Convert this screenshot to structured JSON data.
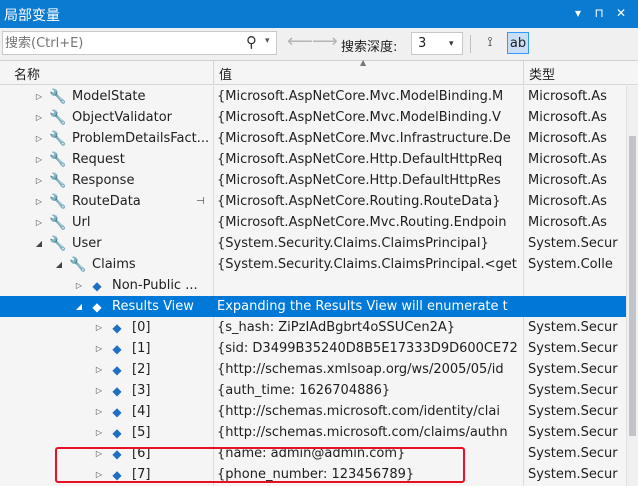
{
  "window": {
    "title": "局部变量",
    "dropdown_glyph": "▾",
    "pin_glyph": "⊓",
    "close_glyph": "✕"
  },
  "toolbar": {
    "search_placeholder": "搜索(Ctrl+E)",
    "search_icon": "⚲",
    "search_dropdown_glyph": "▾",
    "back_glyph": "⟵",
    "forward_glyph": "⟶",
    "depth_label": "搜索深度:",
    "depth_value": "3",
    "depth_dropdown_glyph": "▾",
    "pin_column_glyph": "⟟",
    "view_glyph": "ab"
  },
  "columns": {
    "name": "名称",
    "value": "值",
    "type": "类型"
  },
  "rows": [
    {
      "name": "ModelState",
      "value": "{Microsoft.AspNetCore.Mvc.ModelBinding.M",
      "type": "Microsoft.As",
      "indent": 0,
      "expander": "▷",
      "icon": "wrench-icon",
      "selected": false,
      "pin": false
    },
    {
      "name": "ObjectValidator",
      "value": "{Microsoft.AspNetCore.Mvc.ModelBinding.V",
      "type": "Microsoft.As",
      "indent": 0,
      "expander": "▷",
      "icon": "wrench-icon",
      "selected": false,
      "pin": false
    },
    {
      "name": "ProblemDetailsFact...",
      "value": "{Microsoft.AspNetCore.Mvc.Infrastructure.De",
      "type": "Microsoft.As",
      "indent": 0,
      "expander": "▷",
      "icon": "wrench-icon",
      "selected": false,
      "pin": false
    },
    {
      "name": "Request",
      "value": "{Microsoft.AspNetCore.Http.DefaultHttpReq",
      "type": "Microsoft.As",
      "indent": 0,
      "expander": "▷",
      "icon": "wrench-icon",
      "selected": false,
      "pin": false
    },
    {
      "name": "Response",
      "value": "{Microsoft.AspNetCore.Http.DefaultHttpRes",
      "type": "Microsoft.As",
      "indent": 0,
      "expander": "▷",
      "icon": "wrench-icon",
      "selected": false,
      "pin": false
    },
    {
      "name": "RouteData",
      "value": "{Microsoft.AspNetCore.Routing.RouteData}",
      "type": "Microsoft.As",
      "indent": 0,
      "expander": "▷",
      "icon": "wrench-icon",
      "selected": false,
      "pin": true
    },
    {
      "name": "Url",
      "value": "{Microsoft.AspNetCore.Mvc.Routing.Endpoin",
      "type": "Microsoft.As",
      "indent": 0,
      "expander": "▷",
      "icon": "wrench-icon",
      "selected": false,
      "pin": false
    },
    {
      "name": "User",
      "value": "{System.Security.Claims.ClaimsPrincipal}",
      "type": "System.Secur",
      "indent": 0,
      "expander": "◢",
      "icon": "wrench-icon",
      "selected": false,
      "pin": false
    },
    {
      "name": "Claims",
      "value": "{System.Security.Claims.ClaimsPrincipal.<get",
      "type": "System.Colle",
      "indent": 1,
      "expander": "◢",
      "icon": "wrench-icon",
      "selected": false,
      "pin": false
    },
    {
      "name": "Non-Public ...",
      "value": "",
      "type": "",
      "indent": 2,
      "expander": "▷",
      "icon": "cube-icon",
      "selected": false,
      "pin": false
    },
    {
      "name": "Results View",
      "value": "Expanding the Results View will enumerate t",
      "type": "",
      "indent": 2,
      "expander": "◢",
      "icon": "cube-icon",
      "selected": true,
      "pin": false
    },
    {
      "name": "[0]",
      "value": "{s_hash: ZiPzIAdBgbrt4oSSUCen2A}",
      "type": "System.Secur",
      "indent": 3,
      "expander": "▷",
      "icon": "cube-icon",
      "selected": false,
      "pin": false
    },
    {
      "name": "[1]",
      "value": "{sid: D3499B35240D8B5E17333D9D600CE72",
      "type": "System.Secur",
      "indent": 3,
      "expander": "▷",
      "icon": "cube-icon",
      "selected": false,
      "pin": false
    },
    {
      "name": "[2]",
      "value": "{http://schemas.xmlsoap.org/ws/2005/05/id",
      "type": "System.Secur",
      "indent": 3,
      "expander": "▷",
      "icon": "cube-icon",
      "selected": false,
      "pin": false
    },
    {
      "name": "[3]",
      "value": "{auth_time: 1626704886}",
      "type": "System.Secur",
      "indent": 3,
      "expander": "▷",
      "icon": "cube-icon",
      "selected": false,
      "pin": false
    },
    {
      "name": "[4]",
      "value": "{http://schemas.microsoft.com/identity/clai",
      "type": "System.Secur",
      "indent": 3,
      "expander": "▷",
      "icon": "cube-icon",
      "selected": false,
      "pin": false
    },
    {
      "name": "[5]",
      "value": "{http://schemas.microsoft.com/claims/authn",
      "type": "System.Secur",
      "indent": 3,
      "expander": "▷",
      "icon": "cube-icon",
      "selected": false,
      "pin": false
    },
    {
      "name": "[6]",
      "value": "{name: admin@admin.com}",
      "type": "System.Secur",
      "indent": 3,
      "expander": "▷",
      "icon": "cube-icon",
      "selected": false,
      "pin": false
    },
    {
      "name": "[7]",
      "value": "{phone_number: 123456789}",
      "type": "System.Secur",
      "indent": 3,
      "expander": "▷",
      "icon": "cube-icon",
      "selected": false,
      "pin": false
    }
  ],
  "colors": {
    "title_bar": "#0b7ad1",
    "selected_row": "#0078d7",
    "highlight_box": "#e81123"
  }
}
